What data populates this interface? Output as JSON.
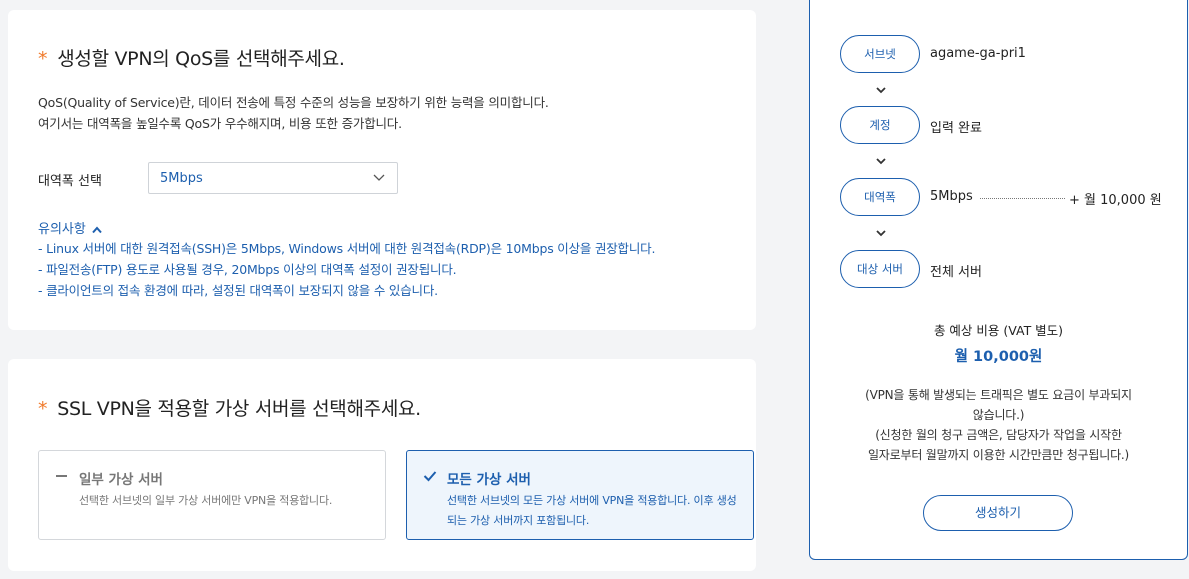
{
  "qos": {
    "title": "생성할 VPN의 QoS를 선택해주세요.",
    "required_mark": "*",
    "desc_line1": "QoS(Quality of Service)란, 데이터 전송에 특정 수준의 성능을 보장하기 위한 능력을 의미합니다.",
    "desc_line2": "여기서는 대역폭을 높일수록 QoS가 우수해지며, 비용 또한 증가합니다.",
    "bandwidth_label": "대역폭 선택",
    "bandwidth_value": "5Mbps",
    "notice_title": "유의사항",
    "notices": [
      "- Linux 서버에 대한 원격접속(SSH)은 5Mbps, Windows 서버에 대한 원격접속(RDP)은 10Mbps 이상을 권장합니다.",
      "- 파일전송(FTP) 용도로 사용될 경우, 20Mbps 이상의 대역폭 설정이 권장됩니다.",
      "- 클라이언트의 접속 환경에 따라, 설정된 대역폭이 보장되지 않을 수 있습니다."
    ]
  },
  "target": {
    "title": "SSL VPN을 적용할 가상 서버를 선택해주세요.",
    "required_mark": "*",
    "options": [
      {
        "title": "일부 가상 서버",
        "desc": "선택한 서브넷의 일부 가상 서버에만 VPN을 적용합니다.",
        "selected": false
      },
      {
        "title": "모든 가상 서버",
        "desc": "선택한 서브넷의 모든 가상 서버에 VPN을 적용합니다. 이후 생성되는 가상 서버까지 포함됩니다.",
        "selected": true
      }
    ]
  },
  "summary": {
    "rows": [
      {
        "label": "서브넷",
        "value": "agame-ga-pri1"
      },
      {
        "label": "계정",
        "value": "입력 완료"
      },
      {
        "label": "대역폭",
        "value": "5Mbps"
      },
      {
        "label": "대상 서버",
        "value": "전체 서버"
      }
    ],
    "bandwidth_price": "+ 월 10,000 원",
    "total_label": "총 예상 비용 (VAT 별도)",
    "total_value": "월 10,000원",
    "note_line1": "(VPN을 통해 발생되는 트래픽은 별도 요금이 부과되지",
    "note_line2": "않습니다.)",
    "note_line3": "(신청한 월의 청구 금액은, 담당자가 작업을 시작한",
    "note_line4": "일자로부터 월말까지 이용한 시간만큼만 청구됩니다.)",
    "create_button": "생성하기"
  },
  "colors": {
    "accent": "#1d5fae",
    "required": "#f07a2b",
    "background": "#f3f4f6"
  }
}
